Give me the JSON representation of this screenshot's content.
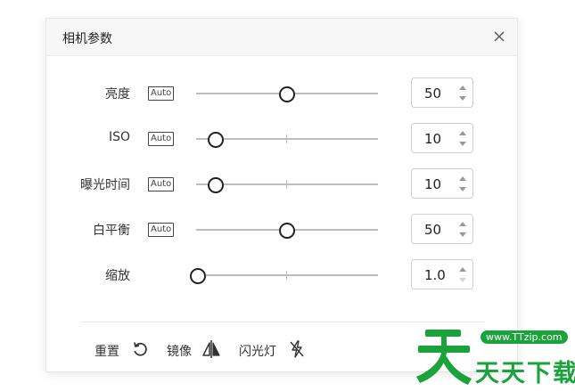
{
  "dialog": {
    "title": "相机参数",
    "close_icon": "close-icon"
  },
  "params": [
    {
      "id": "brightness",
      "label": "亮度",
      "auto": "Auto",
      "value": "50",
      "position": 0.5,
      "up_disabled": false,
      "down_disabled": false
    },
    {
      "id": "iso",
      "label": "ISO",
      "auto": "Auto",
      "value": "10",
      "position": 0.1,
      "up_disabled": false,
      "down_disabled": false
    },
    {
      "id": "exposure",
      "label": "曝光时间",
      "auto": "Auto",
      "value": "10",
      "position": 0.1,
      "up_disabled": false,
      "down_disabled": false
    },
    {
      "id": "white-balance",
      "label": "白平衡",
      "auto": "Auto",
      "value": "50",
      "position": 0.5,
      "up_disabled": false,
      "down_disabled": false
    },
    {
      "id": "zoom",
      "label": "缩放",
      "auto": null,
      "value": "1.0",
      "position": 0.0,
      "up_disabled": false,
      "down_disabled": true
    }
  ],
  "actions": {
    "reset": {
      "label": "重置",
      "icon": "reset-icon"
    },
    "mirror": {
      "label": "镜像",
      "icon": "mirror-icon"
    },
    "flash": {
      "label": "闪光灯",
      "icon": "flash-off-icon"
    }
  },
  "watermark": {
    "url": "www.TTzip.com",
    "text": "天天下载"
  },
  "colors": {
    "watermark_green": "#1aa33a",
    "thumb_border": "#222222",
    "track": "#bdbdbd"
  }
}
